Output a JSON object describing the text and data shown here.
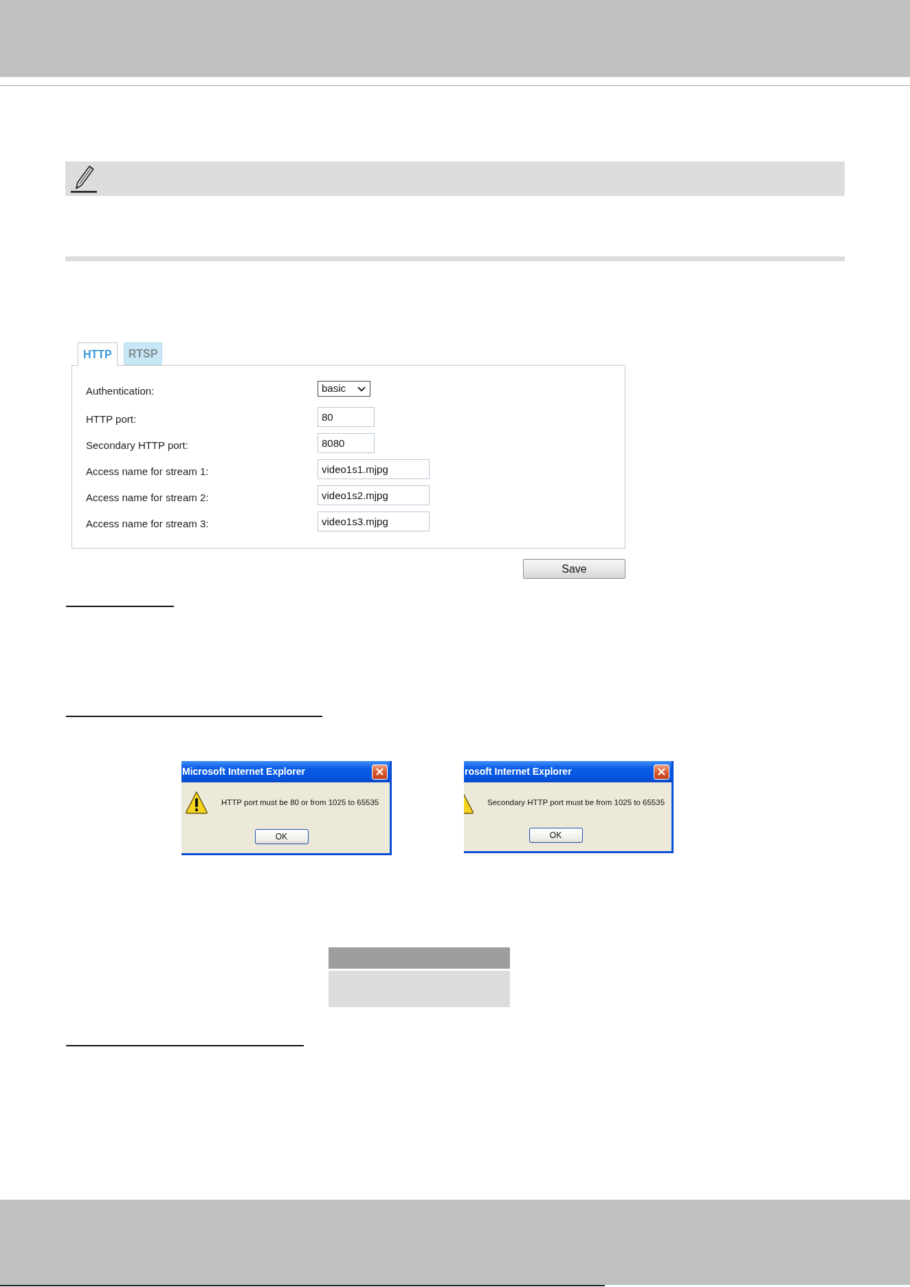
{
  "tabs": [
    {
      "label": "HTTP",
      "selected": true
    },
    {
      "label": "RTSP",
      "selected": false
    }
  ],
  "fields": [
    {
      "label": "Authentication:",
      "kind": "select",
      "value": "basic"
    },
    {
      "label": "HTTP port:",
      "kind": "port",
      "value": "80"
    },
    {
      "label": "Secondary HTTP port:",
      "kind": "port",
      "value": "8080"
    },
    {
      "label": "Access name for stream 1:",
      "kind": "text",
      "value": "video1s1.mjpg"
    },
    {
      "label": "Access name for stream 2:",
      "kind": "text",
      "value": "video1s2.mjpg"
    },
    {
      "label": "Access name for stream 3:",
      "kind": "text",
      "value": "video1s3.mjpg"
    }
  ],
  "save_button": "Save",
  "dialogs": [
    {
      "title": "Microsoft Internet Explorer",
      "message": "HTTP port must be 80 or from 1025 to 65535",
      "button": "OK"
    },
    {
      "title": "rosoft Internet Explorer",
      "message": "Secondary HTTP port must be from 1025 to 65535",
      "button": "OK"
    }
  ]
}
